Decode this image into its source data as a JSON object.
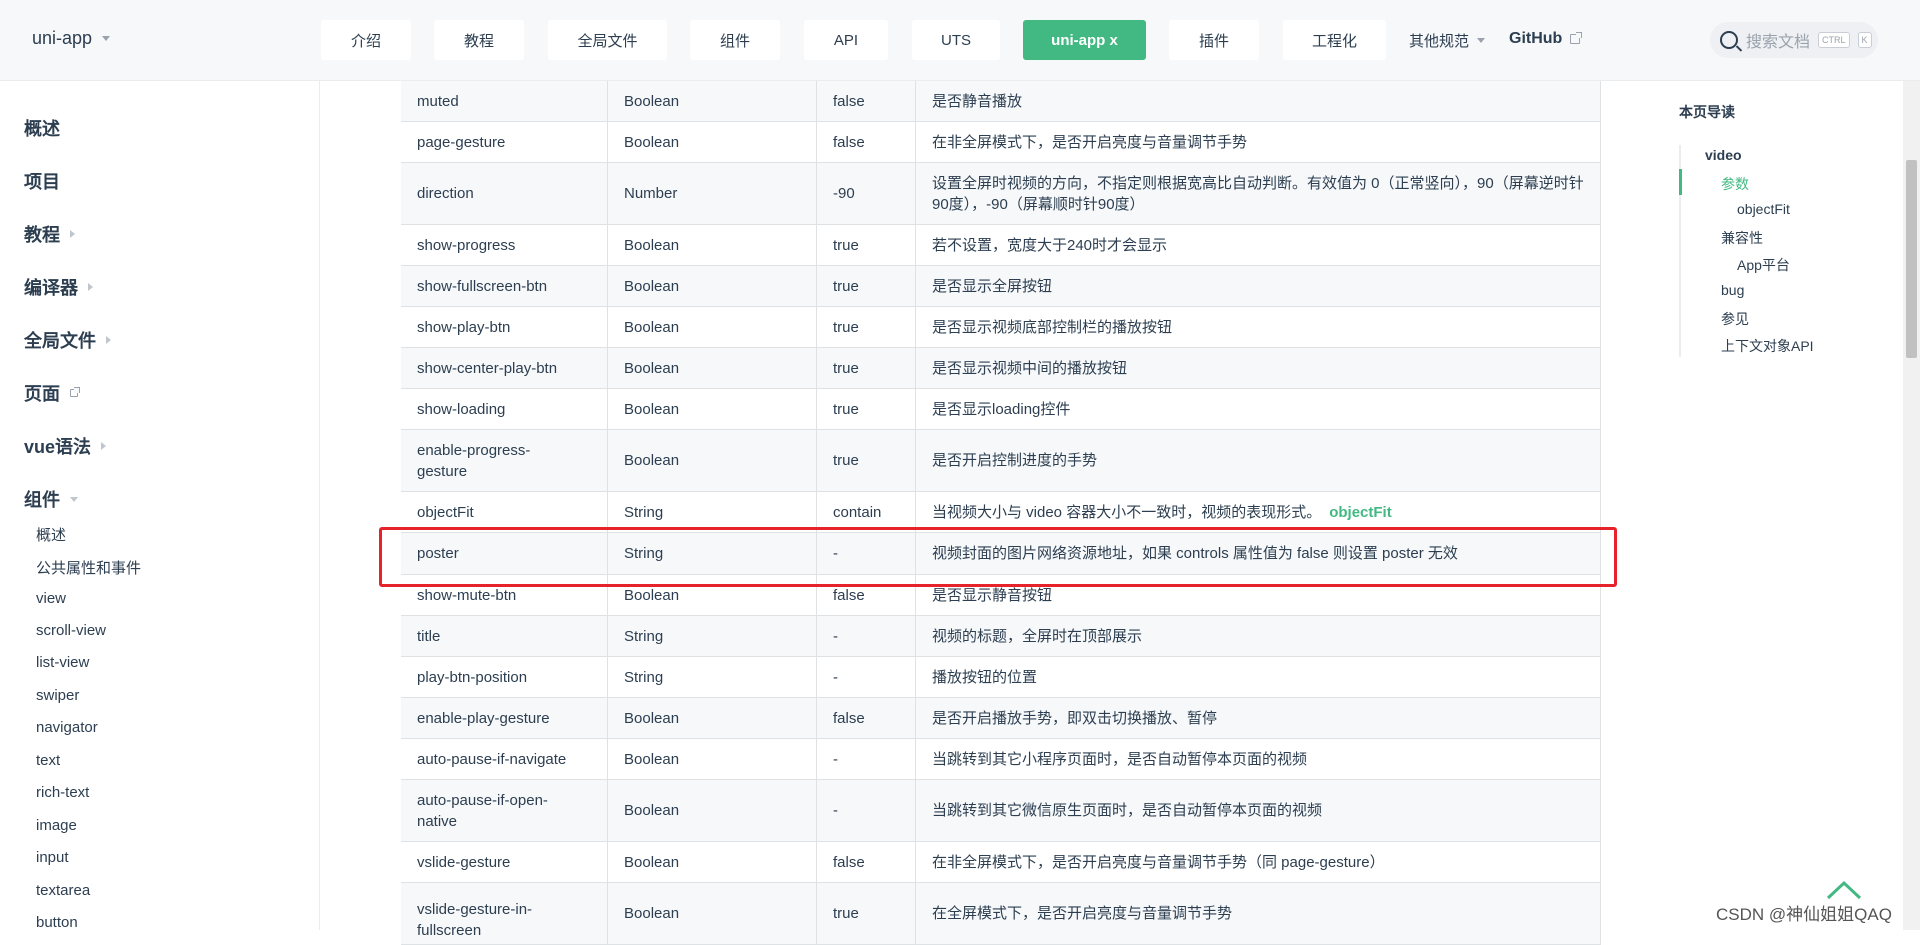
{
  "header": {
    "brand": "uni-app",
    "nav": [
      "介绍",
      "教程",
      "全局文件",
      "组件",
      "API",
      "UTS",
      "uni-app x",
      "插件",
      "工程化"
    ],
    "other": "其他规范",
    "github": "GitHub",
    "search_placeholder": "搜索文档",
    "kbd_ctrl": "CTRL",
    "kbd_k": "K"
  },
  "sidebar": {
    "sections": [
      "概述",
      "项目",
      "教程",
      "编译器",
      "全局文件",
      "页面",
      "vue语法",
      "组件"
    ],
    "items": [
      "概述",
      "公共属性和事件",
      "view",
      "scroll-view",
      "list-view",
      "swiper",
      "navigator",
      "text",
      "rich-text",
      "image",
      "input",
      "textarea",
      "button"
    ]
  },
  "table": {
    "rows": [
      {
        "name": "muted",
        "type": "Boolean",
        "default": "false",
        "desc": "是否静音播放"
      },
      {
        "name": "page-gesture",
        "type": "Boolean",
        "default": "false",
        "desc": "在非全屏模式下，是否开启亮度与音量调节手势"
      },
      {
        "name": "direction",
        "type": "Number",
        "default": "-90",
        "desc": "设置全屏时视频的方向，不指定则根据宽高比自动判断。有效值为 0（正常竖向），90（屏幕逆时针90度），-90（屏幕顺时针90度）"
      },
      {
        "name": "show-progress",
        "type": "Boolean",
        "default": "true",
        "desc": "若不设置，宽度大于240时才会显示"
      },
      {
        "name": "show-fullscreen-btn",
        "type": "Boolean",
        "default": "true",
        "desc": "是否显示全屏按钮"
      },
      {
        "name": "show-play-btn",
        "type": "Boolean",
        "default": "true",
        "desc": "是否显示视频底部控制栏的播放按钮"
      },
      {
        "name": "show-center-play-btn",
        "type": "Boolean",
        "default": "true",
        "desc": "是否显示视频中间的播放按钮"
      },
      {
        "name": "show-loading",
        "type": "Boolean",
        "default": "true",
        "desc": "是否显示loading控件"
      },
      {
        "name": "enable-progress-gesture",
        "type": "Boolean",
        "default": "true",
        "desc": "是否开启控制进度的手势"
      },
      {
        "name": "objectFit",
        "type": "String",
        "default": "contain",
        "desc": "当视频大小与 video 容器大小不一致时，视频的表现形式。"
      },
      {
        "name": "poster",
        "type": "String",
        "default": "-",
        "desc": "视频封面的图片网络资源地址，如果 controls 属性值为 false 则设置 poster 无效"
      },
      {
        "name": "show-mute-btn",
        "type": "Boolean",
        "default": "false",
        "desc": "是否显示静音按钮"
      },
      {
        "name": "title",
        "type": "String",
        "default": "-",
        "desc": "视频的标题，全屏时在顶部展示"
      },
      {
        "name": "play-btn-position",
        "type": "String",
        "default": "-",
        "desc": "播放按钮的位置"
      },
      {
        "name": "enable-play-gesture",
        "type": "Boolean",
        "default": "false",
        "desc": "是否开启播放手势，即双击切换播放、暂停"
      },
      {
        "name": "auto-pause-if-navigate",
        "type": "Boolean",
        "default": "-",
        "desc": "当跳转到其它小程序页面时，是否自动暂停本页面的视频"
      },
      {
        "name": "auto-pause-if-open-native",
        "type": "Boolean",
        "default": "-",
        "desc": "当跳转到其它微信原生页面时，是否自动暂停本页面的视频"
      },
      {
        "name": "vslide-gesture",
        "type": "Boolean",
        "default": "false",
        "desc": "在非全屏模式下，是否开启亮度与音量调节手势（同 page-gesture）"
      },
      {
        "name": "vslide-gesture-in-fullscreen",
        "type": "Boolean",
        "default": "true",
        "desc": "在全屏模式下，是否开启亮度与音量调节手势"
      }
    ],
    "objectfit_link": "objectFit"
  },
  "toc": {
    "title": "本页导读",
    "items": [
      "video",
      "参数",
      "objectFit",
      "兼容性",
      "App平台",
      "bug",
      "参见",
      "上下文对象API"
    ]
  },
  "watermark": "CSDN @神仙姐姐QAQ",
  "colors": {
    "accent": "#42b983",
    "highlight": "#e6232a"
  }
}
